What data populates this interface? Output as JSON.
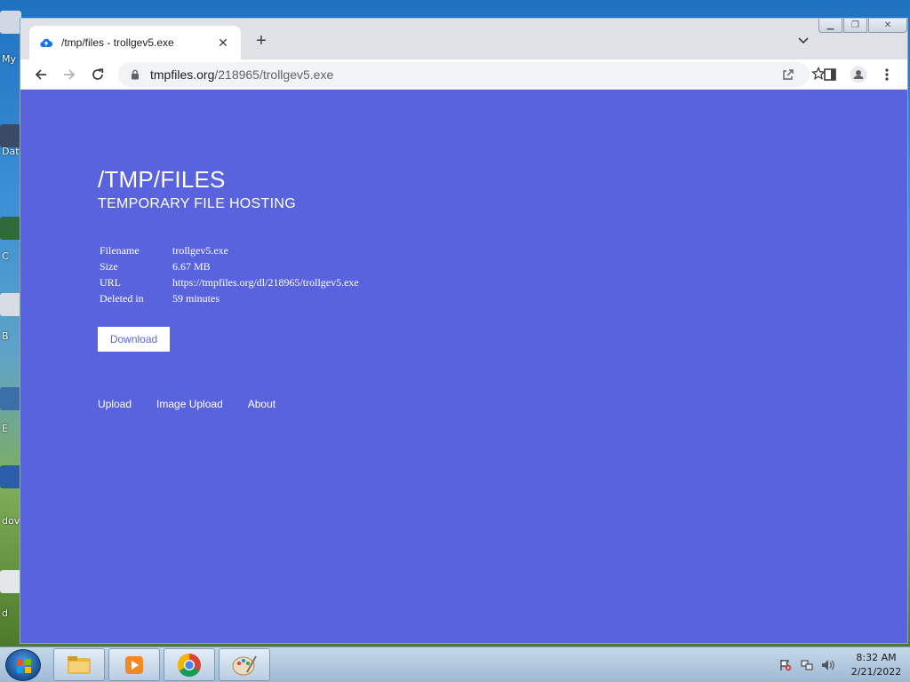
{
  "desktop": {
    "icons": [
      {
        "label": "My",
        "icon": "computer-icon"
      },
      {
        "label": "Dat",
        "icon": "file-icon"
      },
      {
        "label": "C",
        "icon": "file-icon"
      },
      {
        "label": "B",
        "icon": "file-icon"
      },
      {
        "label": "E",
        "icon": "file-icon"
      },
      {
        "label": "dov",
        "icon": "file-icon"
      },
      {
        "label": "d",
        "icon": "file-icon"
      }
    ]
  },
  "browser": {
    "tab": {
      "title": "/tmp/files - trollgev5.exe",
      "favicon": "cloud-upload-icon"
    },
    "address": {
      "host": "tmpfiles.org",
      "path": "/218965/trollgev5.exe"
    }
  },
  "page": {
    "title": "/TMP/FILES",
    "subtitle": "TEMPORARY FILE HOSTING",
    "file_info": [
      {
        "key": "Filename",
        "value": "trollgev5.exe"
      },
      {
        "key": "Size",
        "value": "6.67 MB"
      },
      {
        "key": "URL",
        "value": "https://tmpfiles.org/dl/218965/trollgev5.exe"
      },
      {
        "key": "Deleted in",
        "value": "59 minutes"
      }
    ],
    "download_label": "Download",
    "footer_links": [
      "Upload",
      "Image Upload",
      "About"
    ],
    "background_color": "#5a63de"
  },
  "taskbar": {
    "apps": [
      "file-explorer-icon",
      "media-player-icon",
      "chrome-icon",
      "paint-icon"
    ],
    "clock": {
      "time": "8:32 AM",
      "date": "2/21/2022"
    }
  }
}
